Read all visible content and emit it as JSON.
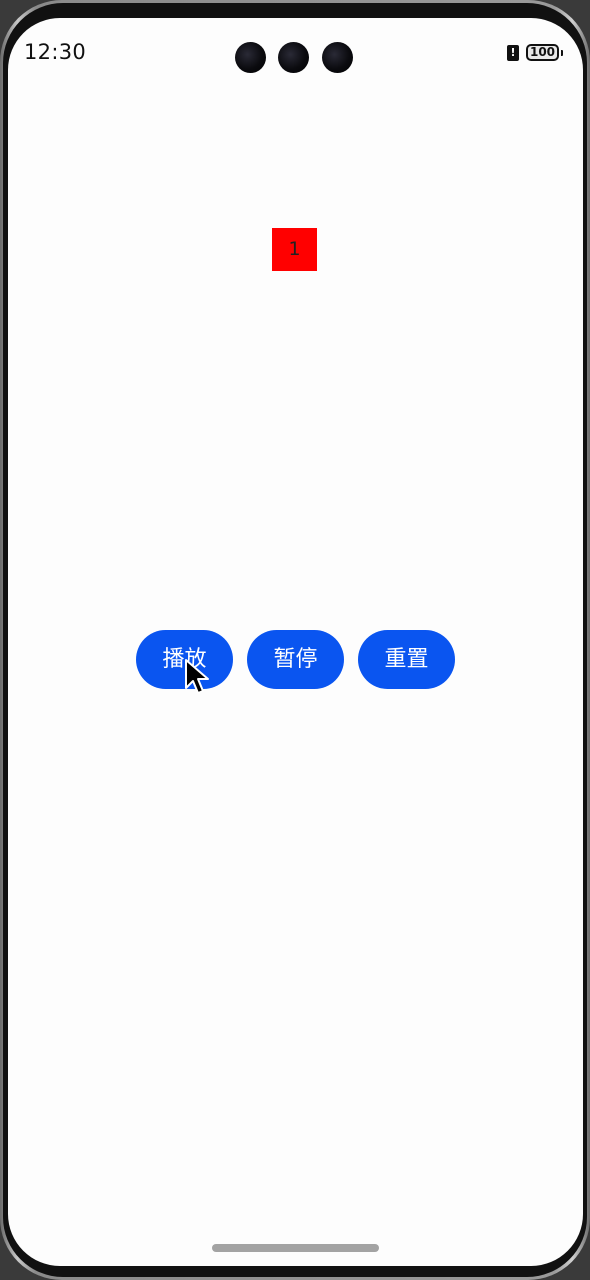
{
  "status_bar": {
    "time": "12:30",
    "battery_level": "100",
    "alert_icon": "exclamation-icon"
  },
  "counter": {
    "value": "1",
    "background_color": "#ff0000"
  },
  "buttons": {
    "play_label": "播放",
    "pause_label": "暂停",
    "reset_label": "重置",
    "color": "#0a55f0"
  },
  "cursor_icon": "mouse-pointer-icon"
}
